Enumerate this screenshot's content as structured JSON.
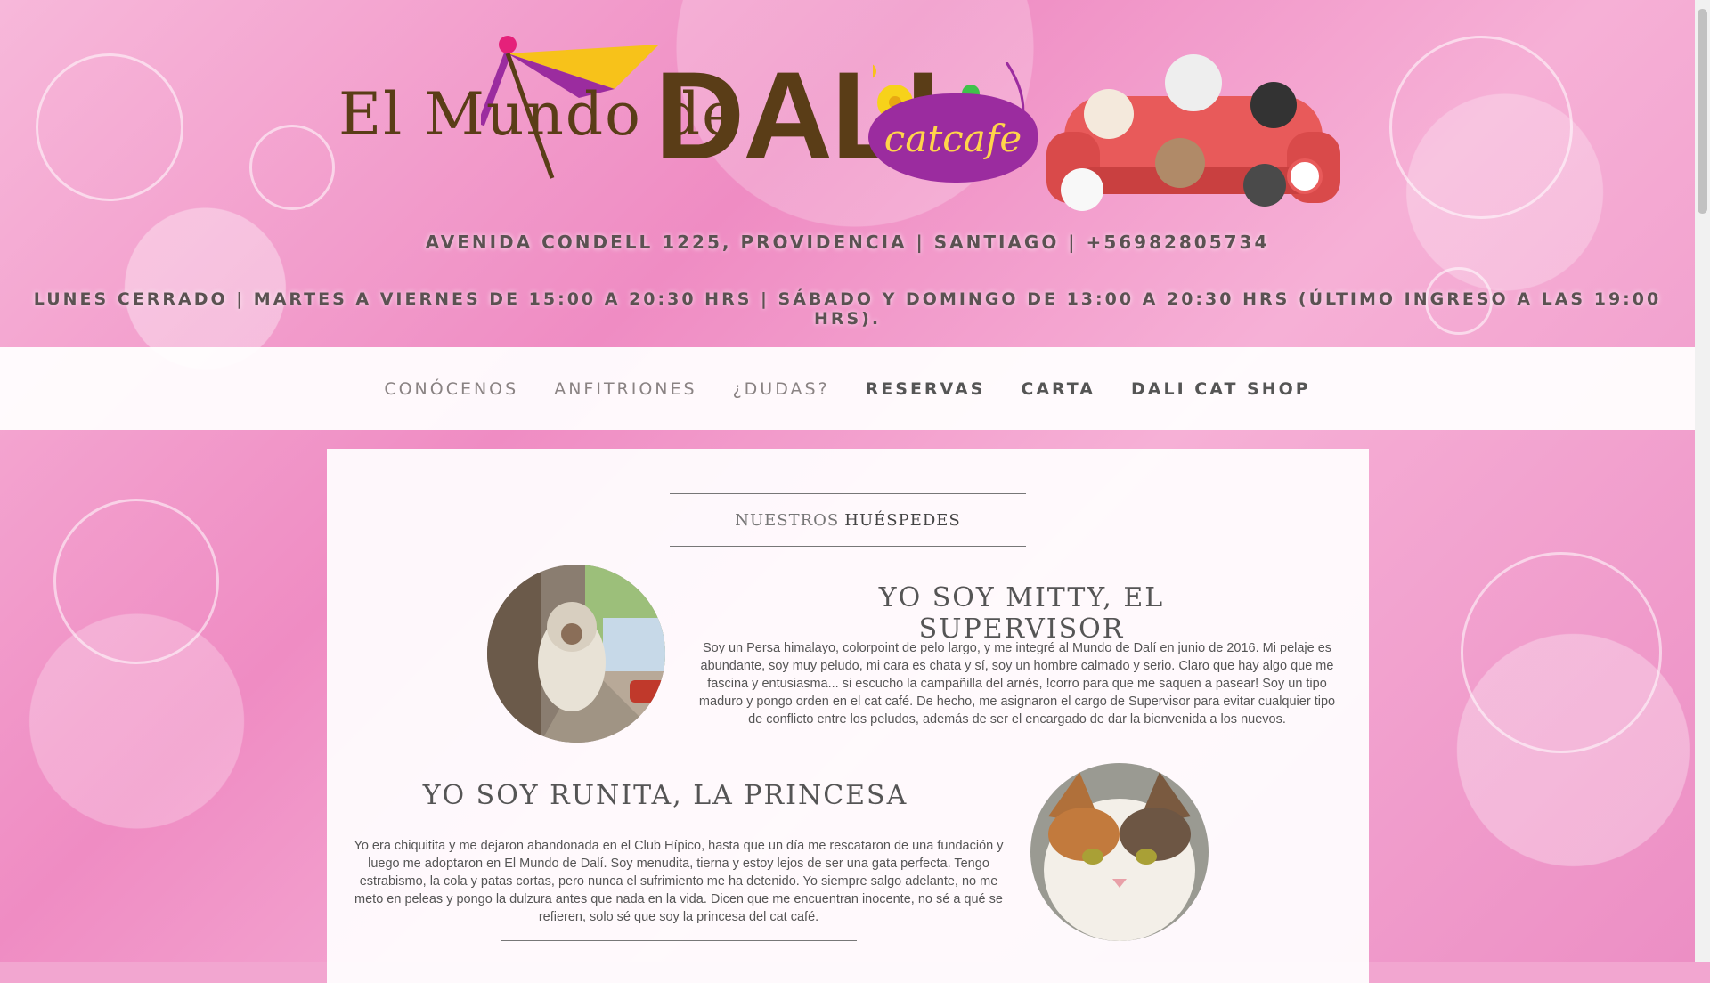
{
  "header": {
    "logo_text_1": "El Mundo de",
    "logo_text_2": "DALI",
    "logo_badge": "catcafe",
    "address": "AVENIDA CONDELL 1225, PROVIDENCIA | SANTIAGO | +56982805734",
    "hours": "LUNES CERRADO | MARTES A VIERNES DE 15:00 A 20:30 HRS | SÁBADO Y DOMINGO DE 13:00 A 20:30 HRS (ÚLTIMO INGRESO A LAS 19:00 HRS)."
  },
  "nav": {
    "items": [
      {
        "label": "CONÓCENOS"
      },
      {
        "label": "ANFITRIONES"
      },
      {
        "label": "¿DUDAS?"
      },
      {
        "label": "RESERVAS"
      },
      {
        "label": "CARTA"
      },
      {
        "label": "DALI CAT SHOP"
      }
    ]
  },
  "section": {
    "title_light": "NUESTROS",
    "title_bold": "HUÉSPEDES"
  },
  "cats": [
    {
      "name": "YO SOY MITTY, EL SUPERVISOR",
      "description": "Soy un Persa himalayo, colorpoint de pelo largo, y me integré al Mundo de Dalí en junio de 2016. Mi pelaje es abundante, soy muy peludo, mi cara es chata y sí, soy un hombre calmado y serio. Claro que hay algo que me fascina y entusiasma... si escucho la campañilla del arnés, !corro para que me saquen a pasear! Soy un tipo maduro y pongo orden en el cat café. De hecho, me asignaron el cargo de Supervisor para evitar cualquier tipo de conflicto entre los peludos, además de ser el encargado de dar la bienvenida a los nuevos."
    },
    {
      "name": "YO SOY RUNITA, LA PRINCESA",
      "description": "Yo era chiquitita y me dejaron abandonada en el Club Hípico, hasta que un día me rescataron de una fundación y luego me adoptaron en El Mundo de Dalí. Soy menudita, tierna y estoy lejos de ser una gata perfecta. Tengo estrabismo, la cola y patas cortas, pero nunca el sufrimiento me ha detenido. Yo siempre salgo adelante, no me meto en peleas y pongo la dulzura antes que nada en la vida. Dicen que me encuentran inocente, no sé a qué se refieren, solo sé que soy la princesa del cat café."
    }
  ],
  "colors": {
    "background": "#f2a6d0",
    "logo_brown": "#5a3d17",
    "badge_purple": "#9b2c9f",
    "text_gray": "#555555"
  }
}
